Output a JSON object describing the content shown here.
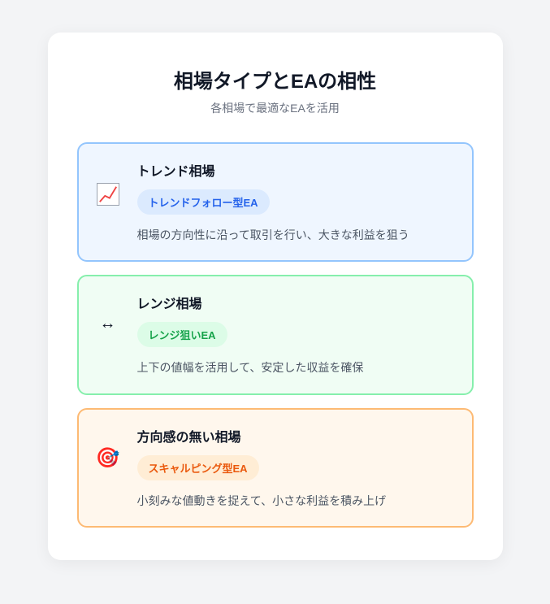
{
  "header": {
    "title": "相場タイプとEAの相性",
    "subtitle": "各相場で最適なEAを活用"
  },
  "sections": [
    {
      "icon": "chart-up-icon",
      "title": "トレンド相場",
      "tag": "トレンドフォロー型EA",
      "desc": "相場の方向性に沿って取引を行い、大きな利益を狙う"
    },
    {
      "icon": "arrows-horizontal-icon",
      "title": "レンジ相場",
      "tag": "レンジ狙いEA",
      "desc": "上下の値幅を活用して、安定した収益を確保"
    },
    {
      "icon": "target-icon",
      "title": "方向感の無い相場",
      "tag": "スキャルピング型EA",
      "desc": "小刻みな値動きを捉えて、小さな利益を積み上げ"
    }
  ]
}
